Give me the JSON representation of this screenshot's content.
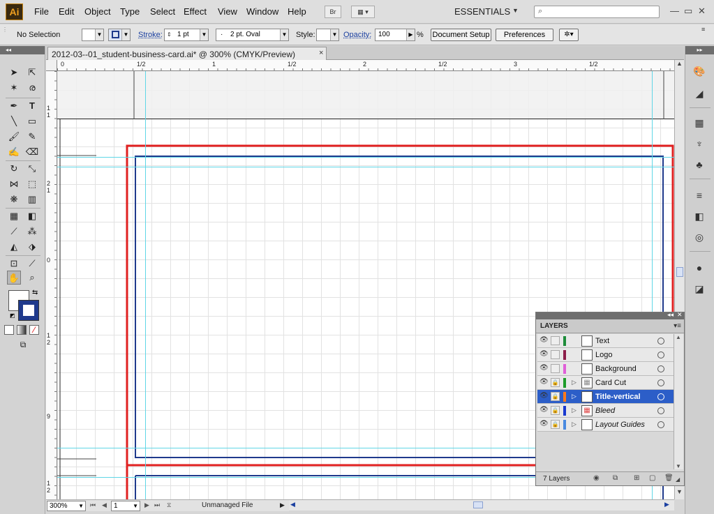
{
  "app": {
    "logo": "Ai"
  },
  "menubar": {
    "items": [
      "File",
      "Edit",
      "Object",
      "Type",
      "Select",
      "Effect",
      "View",
      "Window",
      "Help"
    ],
    "bridge_label": "Br",
    "workspace": "ESSENTIALS"
  },
  "controlbar": {
    "selection": "No Selection",
    "stroke_label": "Stroke:",
    "stroke_weight": "1 pt",
    "brush": "2 pt. Oval",
    "style_label": "Style:",
    "opacity_label": "Opacity:",
    "opacity_value": "100",
    "percent": "%",
    "document_setup": "Document Setup",
    "preferences": "Preferences"
  },
  "document": {
    "title": "2012-03--01_student-business-card.ai* @ 300% (CMYK/Preview)",
    "close": "×"
  },
  "rulers": {
    "top": [
      "0",
      "1/2",
      "1",
      "1/2",
      "2",
      "1/2",
      "3",
      "1/2"
    ],
    "left": [
      "1",
      "1",
      "2",
      "1",
      "0",
      "1",
      "2",
      "9",
      "1",
      "2"
    ]
  },
  "statusbar": {
    "zoom": "300%",
    "page": "1",
    "file_status": "Unmanaged File"
  },
  "layers_panel": {
    "title": "LAYERS",
    "count": "7 Layers",
    "layers": [
      {
        "name": "Text",
        "color": "#1e8c3a",
        "locked": false,
        "expandable": false,
        "italic": false,
        "selected": false
      },
      {
        "name": "Logo",
        "color": "#8c1e4a",
        "locked": false,
        "expandable": false,
        "italic": false,
        "selected": false
      },
      {
        "name": "Background",
        "color": "#e060d8",
        "locked": false,
        "expandable": false,
        "italic": false,
        "selected": false
      },
      {
        "name": "Card Cut",
        "color": "#1e9c2a",
        "locked": true,
        "expandable": true,
        "italic": false,
        "selected": false
      },
      {
        "name": "Title-vertical",
        "color": "#ff7a1a",
        "locked": true,
        "expandable": true,
        "italic": false,
        "selected": true
      },
      {
        "name": "Bleed",
        "color": "#1a3ad0",
        "locked": true,
        "expandable": true,
        "italic": true,
        "selected": false
      },
      {
        "name": "Layout Guides",
        "color": "#4a8ae0",
        "locked": true,
        "expandable": true,
        "italic": true,
        "selected": false
      }
    ]
  },
  "colors": {
    "bleed_red": "#e02020",
    "trim_blue": "#1f3a8c",
    "guide_cyan": "#5fd6e6",
    "selected_layer": "#2c5ec8"
  }
}
